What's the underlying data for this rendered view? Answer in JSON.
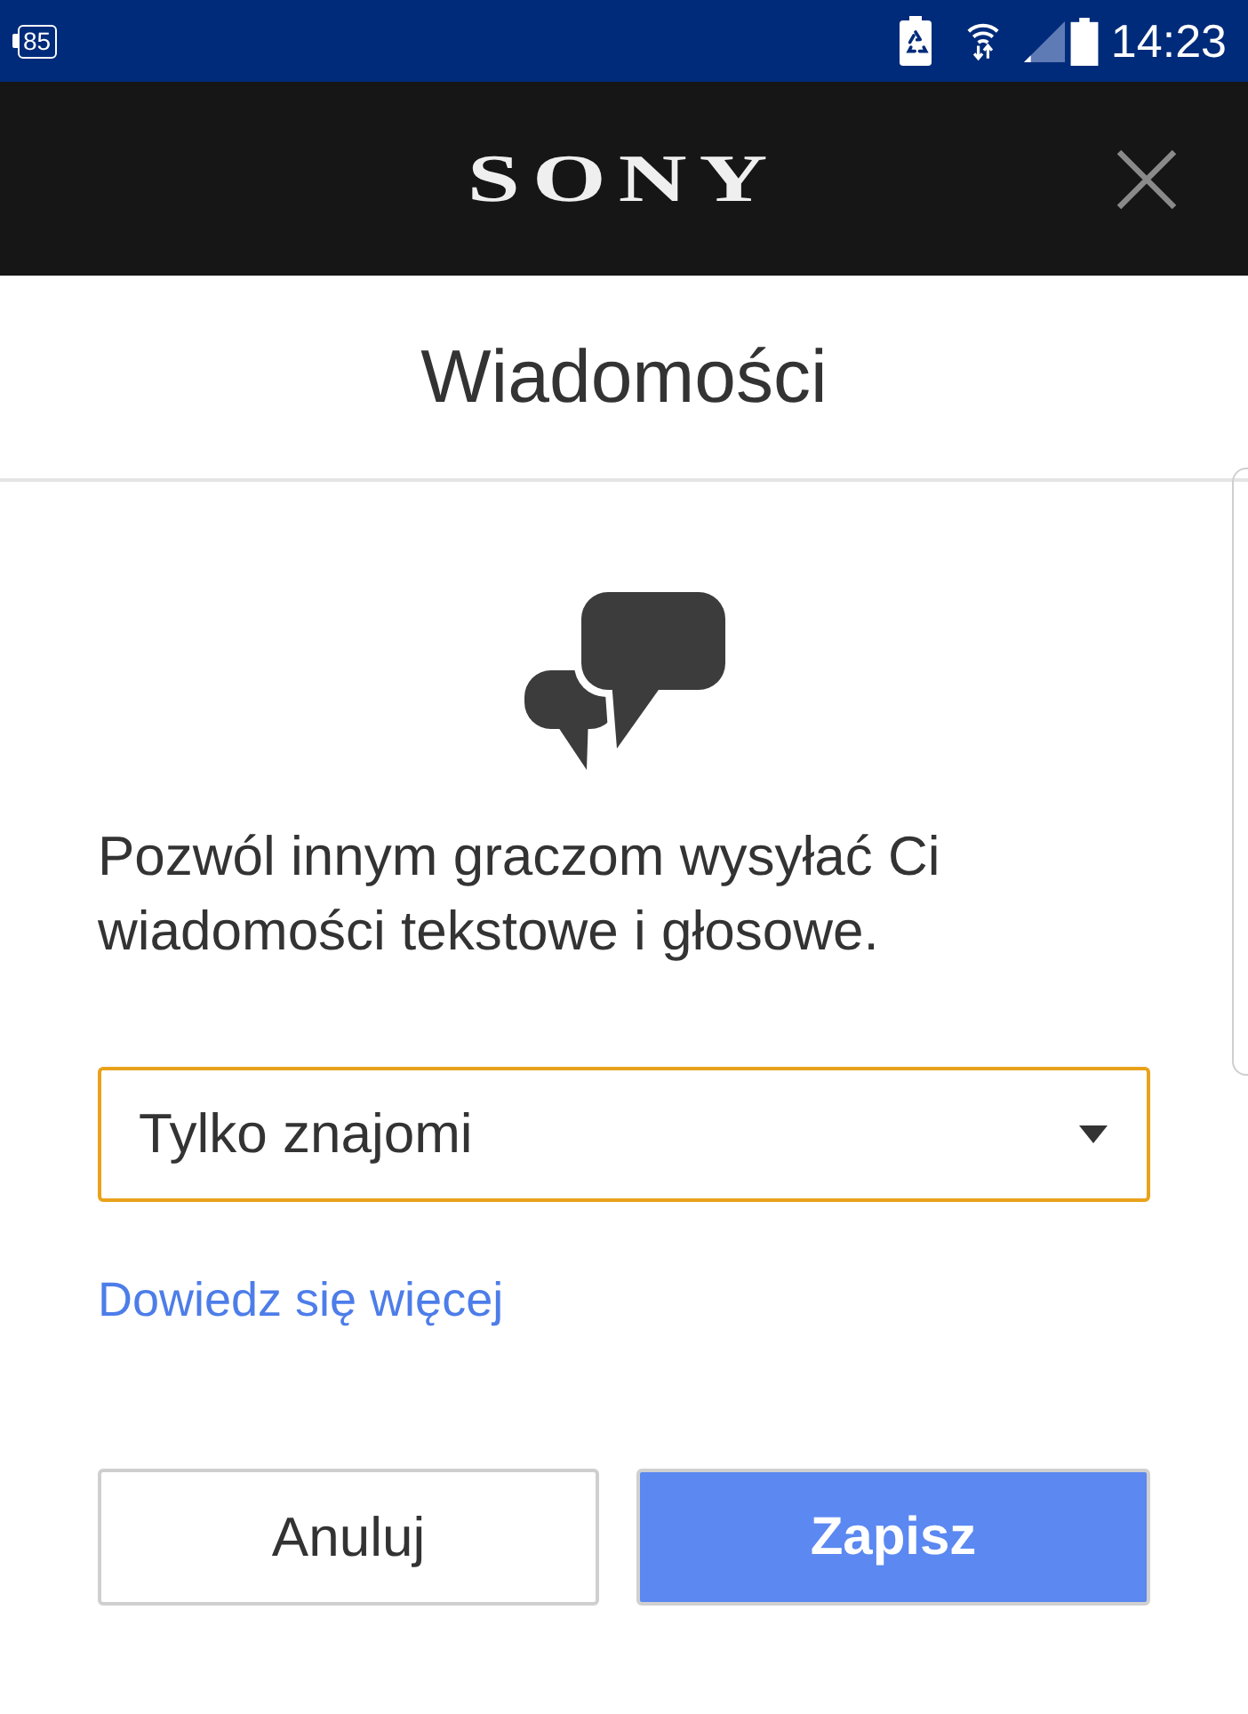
{
  "status_bar": {
    "badge": "85",
    "time": "14:23"
  },
  "header": {
    "logo": "SONY"
  },
  "page": {
    "title": "Wiadomości"
  },
  "content": {
    "description": "Pozwól innym graczom wysyłać Ci wiadomości tekstowe i głosowe.",
    "dropdown": {
      "value": "Tylko znajomi",
      "focused": true
    },
    "link": "Dowiedz się więcej"
  },
  "buttons": [
    {
      "label": "Anuluj",
      "kind": "secondary"
    },
    {
      "label": "Zapisz",
      "kind": "primary"
    }
  ]
}
